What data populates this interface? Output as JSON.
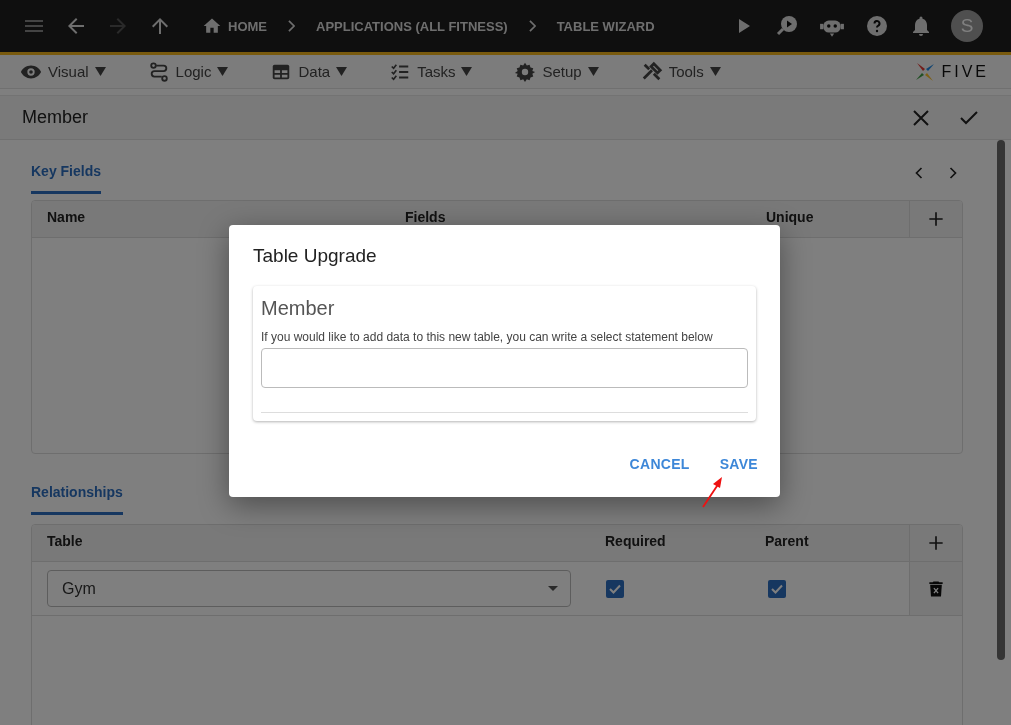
{
  "top_bar": {
    "breadcrumbs": [
      {
        "label": "HOME",
        "kind": "home"
      },
      {
        "label": "APPLICATIONS (ALL FITNESS)",
        "kind": "plain"
      },
      {
        "label": "TABLE WIZARD",
        "kind": "plain"
      }
    ],
    "avatar": "S"
  },
  "menu": [
    {
      "label": "Visual",
      "kind": "eye"
    },
    {
      "label": "Logic",
      "kind": "logic"
    },
    {
      "label": "Data",
      "kind": "data"
    },
    {
      "label": "Tasks",
      "kind": "tasks"
    },
    {
      "label": "Setup",
      "kind": "gear"
    },
    {
      "label": "Tools",
      "kind": "tools"
    }
  ],
  "logo": "FIVE",
  "form": {
    "title": "Member"
  },
  "key_fields": {
    "tab": {
      "label": "Key Fields",
      "selected": true
    },
    "columns": [
      "Name",
      "Fields",
      "Unique"
    ]
  },
  "relationships": {
    "tab": {
      "label": "Relationships",
      "selected": true
    },
    "columns": [
      "Table",
      "Required",
      "Parent"
    ],
    "rows": [
      {
        "table": "Gym",
        "required": true,
        "parent": true
      }
    ]
  },
  "dialog": {
    "title": "Table Upgrade",
    "card_title": "Member",
    "instruction": "If you would like to add data to this new table, you can write a select statement below",
    "buttons": [
      "CANCEL",
      "SAVE"
    ]
  }
}
